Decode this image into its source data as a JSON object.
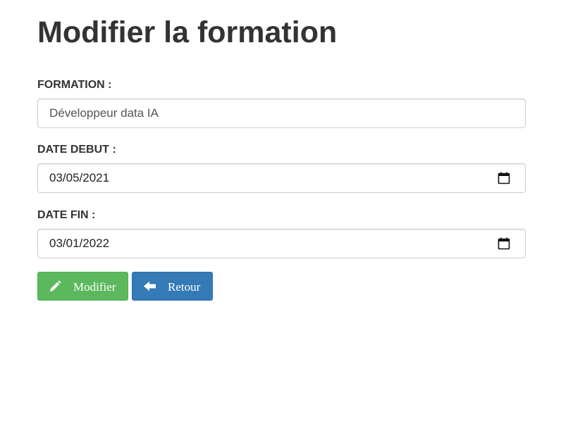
{
  "page": {
    "title": "Modifier la formation"
  },
  "form": {
    "formation": {
      "label": "FORMATION :",
      "value": "Développeur data IA"
    },
    "date_debut": {
      "label": "DATE DEBUT :",
      "value": "03/05/2021"
    },
    "date_fin": {
      "label": "DATE FIN :",
      "value": "03/01/2022"
    }
  },
  "buttons": {
    "modifier": {
      "label": "Modifier",
      "icon": "pencil-icon",
      "color": "#5cb85c"
    },
    "retour": {
      "label": "Retour",
      "icon": "arrow-left-icon",
      "color": "#337ab7"
    }
  }
}
